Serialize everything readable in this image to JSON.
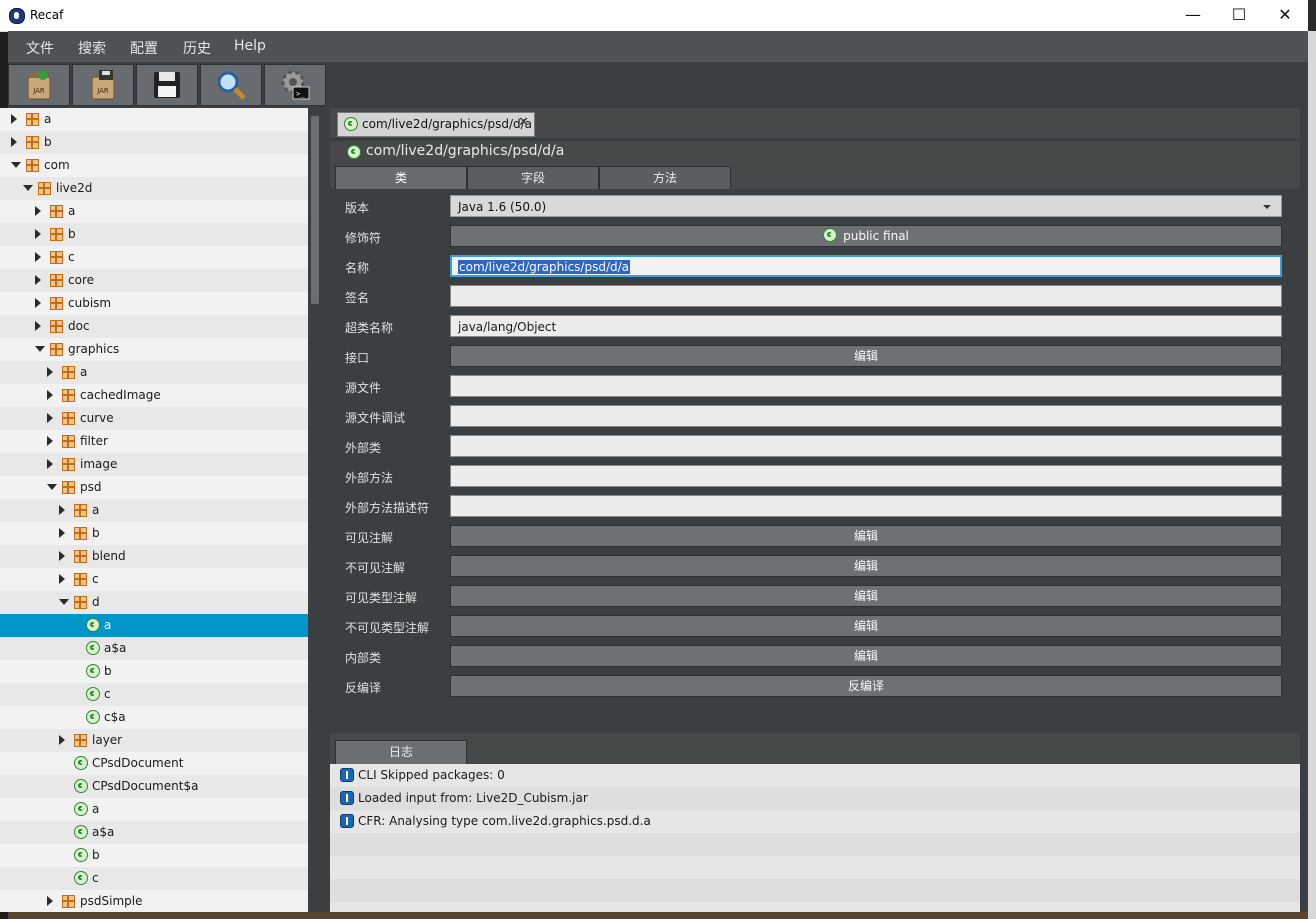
{
  "window": {
    "title": "Recaf",
    "controls": {
      "minimize": "—",
      "maximize": "☐",
      "close": "✕"
    }
  },
  "menu": [
    "文件",
    "搜索",
    "配置",
    "历史",
    "Help"
  ],
  "toolbar": {
    "buttons": [
      "load-jar",
      "export-jar",
      "save",
      "search",
      "settings"
    ],
    "jar_label": "JAR"
  },
  "tree": [
    {
      "label": "a",
      "type": "pkg",
      "depth": 0,
      "arrow": "r"
    },
    {
      "label": "b",
      "type": "pkg",
      "depth": 0,
      "arrow": "r"
    },
    {
      "label": "com",
      "type": "pkg",
      "depth": 0,
      "arrow": "d"
    },
    {
      "label": "live2d",
      "type": "pkg",
      "depth": 1,
      "arrow": "d"
    },
    {
      "label": "a",
      "type": "pkg",
      "depth": 2,
      "arrow": "r"
    },
    {
      "label": "b",
      "type": "pkg",
      "depth": 2,
      "arrow": "r"
    },
    {
      "label": "c",
      "type": "pkg",
      "depth": 2,
      "arrow": "r"
    },
    {
      "label": "core",
      "type": "pkg",
      "depth": 2,
      "arrow": "r"
    },
    {
      "label": "cubism",
      "type": "pkg",
      "depth": 2,
      "arrow": "r"
    },
    {
      "label": "doc",
      "type": "pkg",
      "depth": 2,
      "arrow": "r"
    },
    {
      "label": "graphics",
      "type": "pkg",
      "depth": 2,
      "arrow": "d"
    },
    {
      "label": "a",
      "type": "pkg",
      "depth": 3,
      "arrow": "r"
    },
    {
      "label": "cachedImage",
      "type": "pkg",
      "depth": 3,
      "arrow": "r"
    },
    {
      "label": "curve",
      "type": "pkg",
      "depth": 3,
      "arrow": "r"
    },
    {
      "label": "filter",
      "type": "pkg",
      "depth": 3,
      "arrow": "r"
    },
    {
      "label": "image",
      "type": "pkg",
      "depth": 3,
      "arrow": "r"
    },
    {
      "label": "psd",
      "type": "pkg",
      "depth": 3,
      "arrow": "d"
    },
    {
      "label": "a",
      "type": "pkg",
      "depth": 4,
      "arrow": "r"
    },
    {
      "label": "b",
      "type": "pkg",
      "depth": 4,
      "arrow": "r"
    },
    {
      "label": "blend",
      "type": "pkg",
      "depth": 4,
      "arrow": "r"
    },
    {
      "label": "c",
      "type": "pkg",
      "depth": 4,
      "arrow": "r"
    },
    {
      "label": "d",
      "type": "pkg",
      "depth": 4,
      "arrow": "d"
    },
    {
      "label": "a",
      "type": "cls",
      "depth": 5,
      "arrow": "",
      "selected": true
    },
    {
      "label": "a$a",
      "type": "cls",
      "depth": 5,
      "arrow": ""
    },
    {
      "label": "b",
      "type": "cls",
      "depth": 5,
      "arrow": ""
    },
    {
      "label": "c",
      "type": "cls",
      "depth": 5,
      "arrow": ""
    },
    {
      "label": "c$a",
      "type": "cls",
      "depth": 5,
      "arrow": ""
    },
    {
      "label": "layer",
      "type": "pkg",
      "depth": 4,
      "arrow": "r"
    },
    {
      "label": "CPsdDocument",
      "type": "cls",
      "depth": 4,
      "arrow": ""
    },
    {
      "label": "CPsdDocument$a",
      "type": "cls",
      "depth": 4,
      "arrow": ""
    },
    {
      "label": "a",
      "type": "cls",
      "depth": 4,
      "arrow": ""
    },
    {
      "label": "a$a",
      "type": "cls",
      "depth": 4,
      "arrow": ""
    },
    {
      "label": "b",
      "type": "cls",
      "depth": 4,
      "arrow": ""
    },
    {
      "label": "c",
      "type": "cls",
      "depth": 4,
      "arrow": ""
    },
    {
      "label": "psdSimple",
      "type": "pkg",
      "depth": 3,
      "arrow": "r"
    }
  ],
  "editor": {
    "file_tab": "com/live2d/graphics/psd/d/a",
    "file_tab_close": "✕",
    "heading": "com/live2d/graphics/psd/d/a",
    "sub_tabs": [
      "类",
      "字段",
      "方法"
    ],
    "fields": [
      {
        "label": "版本",
        "kind": "combo",
        "value": "Java 1.6 (50.0)"
      },
      {
        "label": "修饰符",
        "kind": "btn",
        "value": "public final",
        "icon": true
      },
      {
        "label": "名称",
        "kind": "focus",
        "value": "com/live2d/graphics/psd/d/a"
      },
      {
        "label": "签名",
        "kind": "txt",
        "value": ""
      },
      {
        "label": "超类名称",
        "kind": "txt",
        "value": "java/lang/Object"
      },
      {
        "label": "接口",
        "kind": "btn",
        "value": "编辑"
      },
      {
        "label": "源文件",
        "kind": "txt",
        "value": ""
      },
      {
        "label": "源文件调试",
        "kind": "txt",
        "value": ""
      },
      {
        "label": "外部类",
        "kind": "txt",
        "value": ""
      },
      {
        "label": "外部方法",
        "kind": "txt",
        "value": ""
      },
      {
        "label": "外部方法描述符",
        "kind": "txt",
        "value": ""
      },
      {
        "label": "可见注解",
        "kind": "btn",
        "value": "编辑"
      },
      {
        "label": "不可见注解",
        "kind": "btn",
        "value": "编辑"
      },
      {
        "label": "可见类型注解",
        "kind": "btn",
        "value": "编辑"
      },
      {
        "label": "不可见类型注解",
        "kind": "btn",
        "value": "编辑"
      },
      {
        "label": "内部类",
        "kind": "btn",
        "value": "编辑"
      },
      {
        "label": "反编译",
        "kind": "btn",
        "value": "反编译"
      }
    ]
  },
  "log": {
    "tab": "日志",
    "entries": [
      "CLI Skipped packages: 0",
      "Loaded input from: Live2D_Cubism.jar",
      "CFR: Analysing type com.live2d.graphics.psd.d.a"
    ]
  }
}
